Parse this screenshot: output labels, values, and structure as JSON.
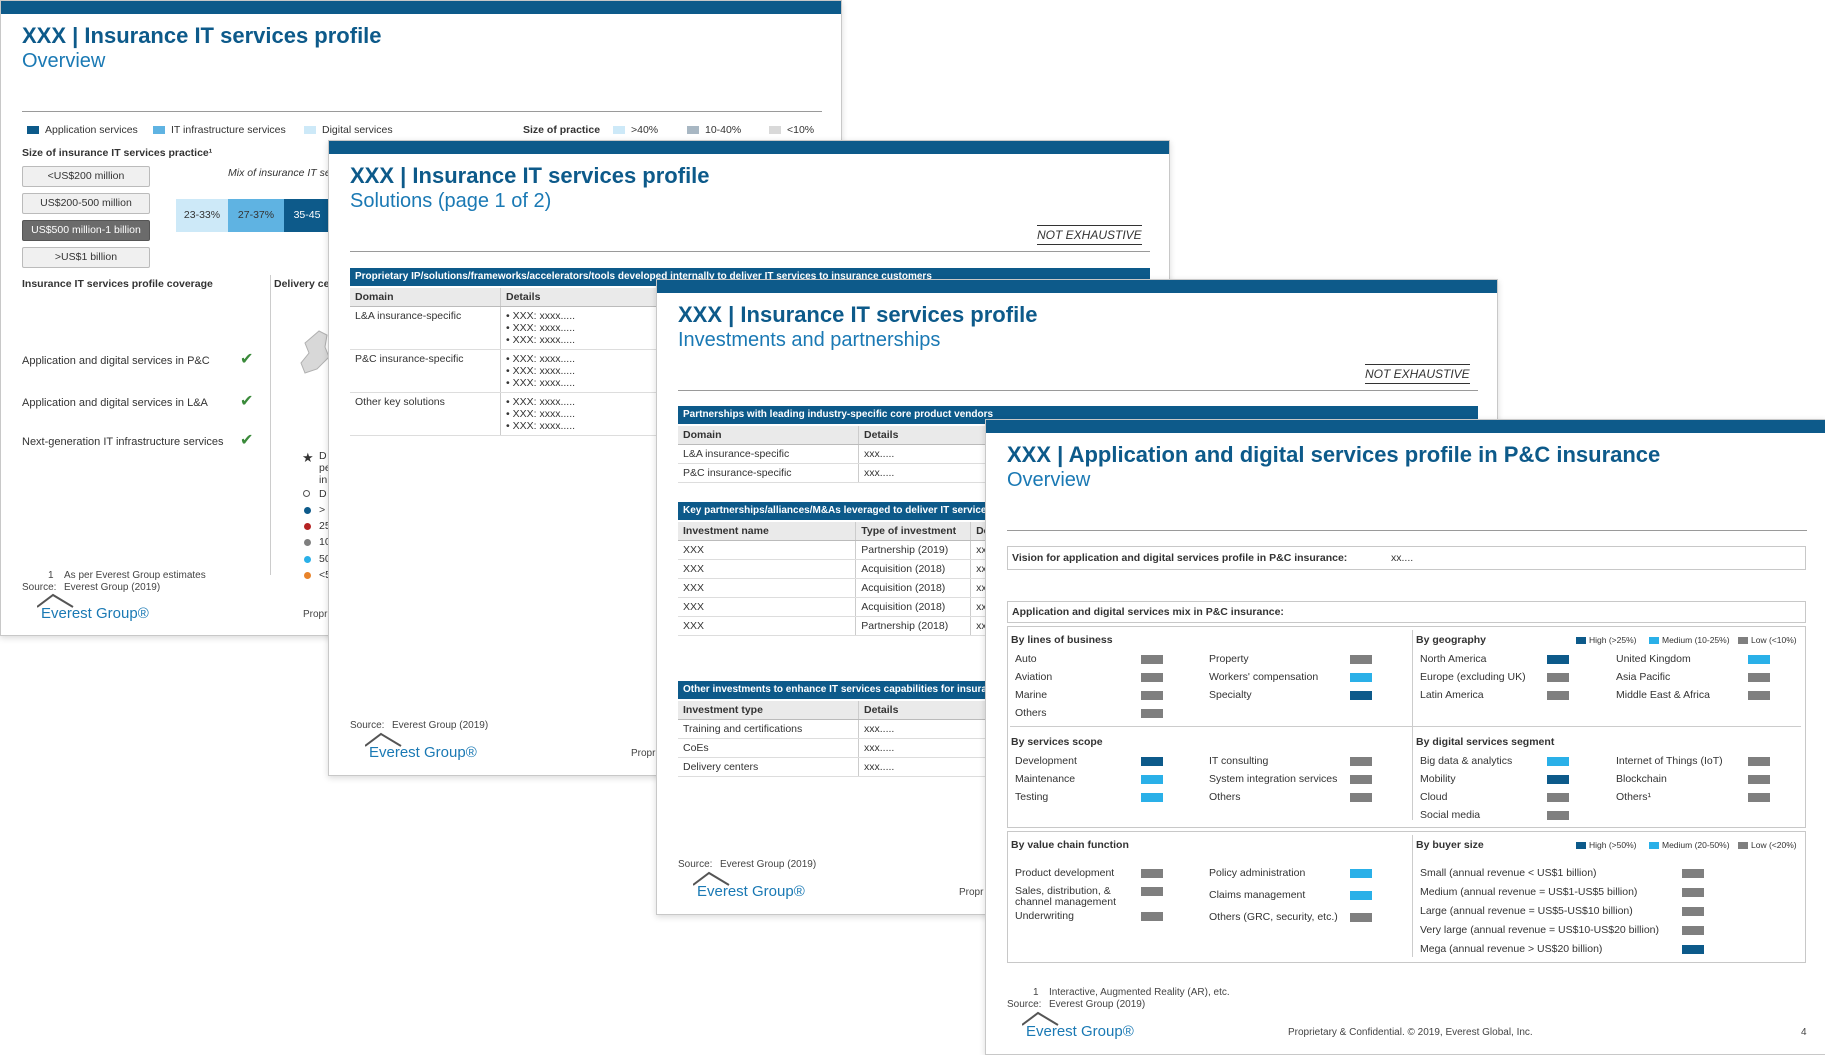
{
  "colors": {
    "navy": "#0d5a8a",
    "medium": "#2ab0e8",
    "low": "#7f7f7f",
    "light": "#cde9f8",
    "accent": "#1a79b4"
  },
  "slide1": {
    "title": "XXX | Insurance IT services profile",
    "subtitle": "Overview",
    "legend": [
      "Application services",
      "IT infrastructure services",
      "Digital services"
    ],
    "size_label": "Size of practice",
    "size_legend": [
      ">40%",
      "10-40%",
      "<10%"
    ],
    "practice_heading": "Size of insurance IT services practice¹",
    "practice_options": [
      "<US$200 million",
      "US$200-500 million",
      "US$500 million-1 billion",
      ">US$1 billion"
    ],
    "mix_label": "Mix of insurance IT se",
    "mix_values": [
      "23-33%",
      "27-37%",
      "35-45"
    ],
    "coverage_heading": "Insurance IT services profile coverage",
    "delivery_heading": "Delivery ce",
    "coverage_items": [
      "Application and digital services in P&C",
      "Application and digital services in L&A",
      "Next-generation IT infrastructure services"
    ],
    "delivery_fragments": [
      "D",
      "pe",
      "in",
      "D",
      "",
      ">",
      "25",
      "10",
      "50",
      "<5"
    ],
    "footnote_num": "1",
    "footnote": "As per Everest Group estimates",
    "source_label": "Source:",
    "source": "Everest Group (2019)",
    "logo": "Everest Group®",
    "prop": "Propr"
  },
  "slide2": {
    "title": "XXX | Insurance IT services profile",
    "subtitle": "Solutions (page 1 of 2)",
    "not_exhaustive": "NOT EXHAUSTIVE",
    "section": "Proprietary IP/solutions/frameworks/accelerators/tools developed internally to deliver IT services to insurance customers",
    "headers": [
      "Domain",
      "Details"
    ],
    "rows": [
      {
        "domain": "L&A insurance-specific",
        "details": [
          "XXX: xxxx.....",
          "XXX: xxxx.....",
          "XXX: xxxx....."
        ]
      },
      {
        "domain": "P&C insurance-specific",
        "details": [
          "XXX: xxxx.....",
          "XXX: xxxx.....",
          "XXX: xxxx....."
        ]
      },
      {
        "domain": "Other key solutions",
        "details": [
          "XXX: xxxx.....",
          "XXX: xxxx.....",
          "XXX: xxxx....."
        ]
      }
    ],
    "source_label": "Source:",
    "source": "Everest Group (2019)",
    "logo": "Everest Group®",
    "prop": "Propr"
  },
  "slide3": {
    "title": "XXX | Insurance IT services profile",
    "subtitle": "Investments and partnerships",
    "not_exhaustive": "NOT EXHAUSTIVE",
    "sec1": "Partnerships with leading industry-specific core product vendors",
    "sec1_headers": [
      "Domain",
      "Details"
    ],
    "sec1_rows": [
      [
        "L&A insurance-specific",
        "xxx....."
      ],
      [
        "P&C insurance-specific",
        "xxx....."
      ]
    ],
    "sec2": "Key partnerships/alliances/M&As leveraged to deliver IT services",
    "sec2_headers": [
      "Investment name",
      "Type of investment",
      "Det"
    ],
    "sec2_rows": [
      [
        "XXX",
        "Partnership (2019)",
        "xxx"
      ],
      [
        "XXX",
        "Acquisition (2018)",
        "xxx"
      ],
      [
        "XXX",
        "Acquisition (2018)",
        "xxx"
      ],
      [
        "XXX",
        "Acquisition (2018)",
        "xxx"
      ],
      [
        "XXX",
        "Partnership (2018)",
        "xxx"
      ]
    ],
    "sec3": "Other investments to enhance IT services capabilities for insurance",
    "sec3_headers": [
      "Investment type",
      "Details"
    ],
    "sec3_rows": [
      [
        "Training and certifications",
        "xxx....."
      ],
      [
        "CoEs",
        "xxx....."
      ],
      [
        "Delivery centers",
        "xxx....."
      ]
    ],
    "source_label": "Source:",
    "source": "Everest Group (2019)",
    "logo": "Everest Group®",
    "prop": "Propr"
  },
  "slide4": {
    "title": "XXX | Application and digital services profile in P&C insurance",
    "subtitle": "Overview",
    "vision_label": "Vision for application and digital services profile in P&C insurance:",
    "vision_value": "xx....",
    "mix_label": "Application and digital services mix in P&C insurance:",
    "legend_top": [
      "High (>25%)",
      "Medium (10-25%)",
      "Low (<10%)"
    ],
    "legend_bottom": [
      "High (>50%)",
      "Medium (20-50%)",
      "Low (<20%)"
    ],
    "lob_heading": "By lines of business",
    "lob": [
      [
        "Auto",
        "low"
      ],
      [
        "Aviation",
        "low"
      ],
      [
        "Marine",
        "low"
      ],
      [
        "Others",
        "low"
      ],
      [
        "Property",
        "low"
      ],
      [
        "Workers' compensation",
        "medium"
      ],
      [
        "Specialty",
        "high"
      ]
    ],
    "geo_heading": "By geography",
    "geo": [
      [
        "North America",
        "high"
      ],
      [
        "Europe (excluding UK)",
        "low"
      ],
      [
        "Latin America",
        "low"
      ],
      [
        "United Kingdom",
        "medium"
      ],
      [
        "Asia Pacific",
        "low"
      ],
      [
        "Middle East & Africa",
        "low"
      ]
    ],
    "scope_heading": "By services scope",
    "scope": [
      [
        "Development",
        "high"
      ],
      [
        "Maintenance",
        "medium"
      ],
      [
        "Testing",
        "medium"
      ],
      [
        "IT consulting",
        "low"
      ],
      [
        "System integration services",
        "low"
      ],
      [
        "Others",
        "low"
      ]
    ],
    "digital_heading": "By digital services segment",
    "digital": [
      [
        "Big data & analytics",
        "medium"
      ],
      [
        "Mobility",
        "high"
      ],
      [
        "Cloud",
        "low"
      ],
      [
        "Social media",
        "low"
      ],
      [
        "Internet of Things (IoT)",
        "low"
      ],
      [
        "Blockchain",
        "low"
      ],
      [
        "Others¹",
        "low"
      ]
    ],
    "value_heading": "By value chain function",
    "value": [
      [
        "Product development",
        "low"
      ],
      [
        "Sales, distribution, &",
        "low"
      ],
      [
        "Underwriting",
        "low"
      ],
      [
        "Policy administration",
        "medium"
      ],
      [
        "Claims management",
        "medium"
      ],
      [
        "Others (GRC, security, etc.)",
        "low"
      ]
    ],
    "value_extra": "channel management",
    "buyer_heading": "By buyer size",
    "buyer": [
      [
        "Small (annual revenue < US$1 billion)",
        "low"
      ],
      [
        "Medium (annual revenue = US$1-US$5 billion)",
        "low"
      ],
      [
        "Large (annual revenue = US$5-US$10 billion)",
        "low"
      ],
      [
        "Very large (annual revenue = US$10-US$20 billion)",
        "low"
      ],
      [
        "Mega (annual revenue > US$20 billion)",
        "high"
      ]
    ],
    "footnote_num": "1",
    "footnote": "Interactive, Augmented Reality (AR), etc.",
    "source_label": "Source:",
    "source": "Everest Group (2019)",
    "logo": "Everest Group®",
    "prop": "Proprietary & Confidential. © 2019, Everest Global, Inc.",
    "page": "4"
  }
}
